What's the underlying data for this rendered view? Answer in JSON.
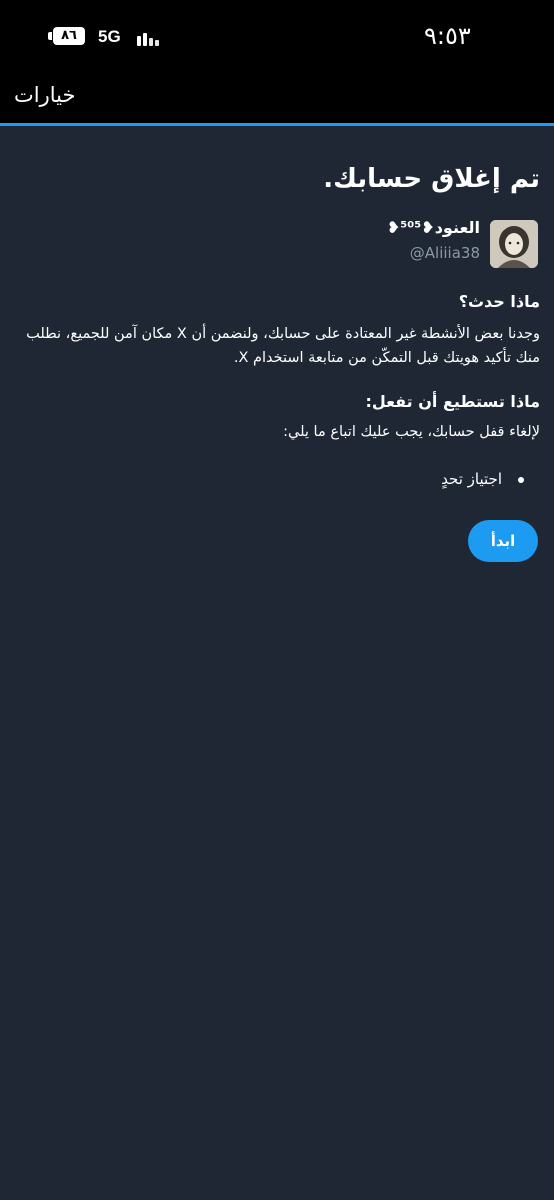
{
  "status_bar": {
    "time": "٩:٥٣",
    "battery": "٨٦",
    "network": "5G"
  },
  "header": {
    "title": "خيارات"
  },
  "page": {
    "title": "تم إغلاق حسابك.",
    "user": {
      "name": "العنود❥⁵⁰⁵❥",
      "handle": "@Aliiia38"
    },
    "what_happened": {
      "heading": "ماذا حدث؟",
      "body": "وجدنا بعض الأنشطة غير المعتادة على حسابك، ولنضمن أن X مكان آمن للجميع، نطلب منك تأكيد هويتك قبل التمكّن من متابعة استخدام X."
    },
    "what_you_can_do": {
      "heading": "ماذا تستطيع أن تفعل:",
      "body": "لإلغاء قفل حسابك، يجب عليك اتباع ما يلي:",
      "steps": [
        "اجتياز تحدٍ"
      ]
    },
    "start_button": "ابدأ"
  },
  "colors": {
    "background": "#1e2733",
    "bar_background": "#000000",
    "accent": "#1d9bf0",
    "secondary_text": "#8b98a5"
  }
}
